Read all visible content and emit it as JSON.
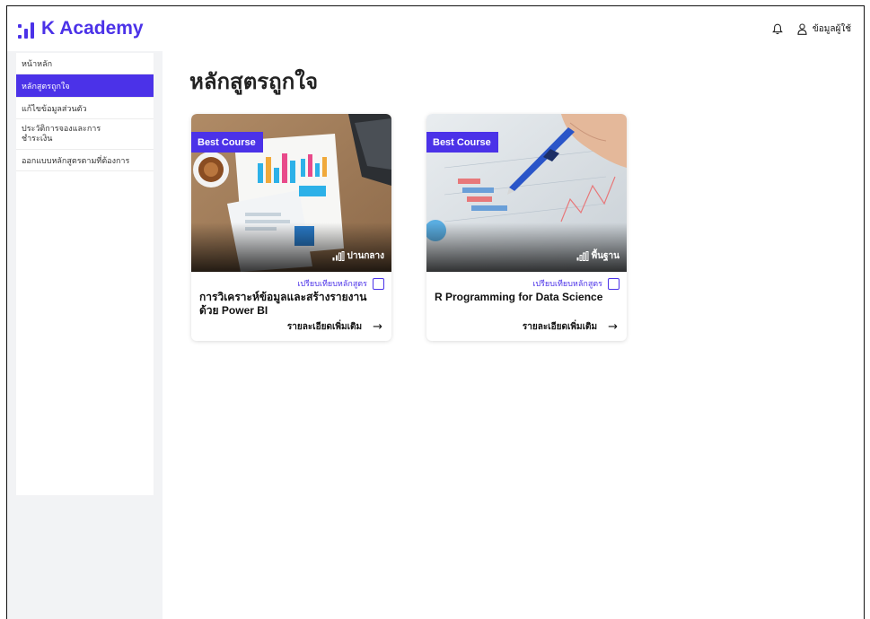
{
  "header": {
    "brand": "K Academy",
    "user_label": "ข้อมูลผู้ใช้"
  },
  "sidebar": {
    "items": [
      {
        "label": "หน้าหลัก"
      },
      {
        "label": "หลักสูตรถูกใจ",
        "active": true
      },
      {
        "label": "แก้ไขข้อมูลส่วนตัว"
      },
      {
        "label": "ประวัติการจองและการชำระเงิน"
      },
      {
        "label": "ออกแบบหลักสูตรตามที่ต้องการ"
      }
    ]
  },
  "main": {
    "title": "หลักสูตรถูกใจ",
    "courses": [
      {
        "badge": "Best Course",
        "level": "ปานกลาง",
        "compare_label": "เปรียบเทียบหลักสูตร",
        "title": "การวิเคราะห์ข้อมูลและสร้างรายงานด้วย Power BI",
        "details_label": "รายละเอียดเพิ่มเติม"
      },
      {
        "badge": "Best Course",
        "level": "พื้นฐาน",
        "compare_label": "เปรียบเทียบหลักสูตร",
        "title": "R Programming for Data Science",
        "details_label": "รายละเอียดเพิ่มเติม"
      }
    ]
  },
  "colors": {
    "accent": "#4b32e8",
    "sidebar_bg": "#ffffff",
    "page_bg": "#f2f3f5"
  },
  "icons": {
    "bell": "bell-icon",
    "user": "user-icon",
    "level": "signal-bars-icon",
    "arrow": "arrow-right-icon",
    "logo": "k-academy-logo-icon"
  }
}
